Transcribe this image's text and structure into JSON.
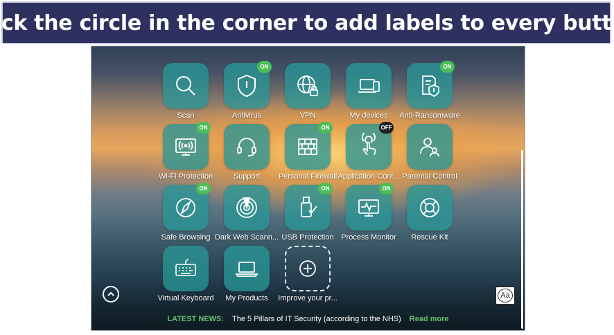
{
  "banner": {
    "text": "Click the circle in the corner to add labels to every button"
  },
  "colors": {
    "banner_bg": "#2e3160",
    "tile_bg": "#2a9696",
    "status_on": "#4dbd5a",
    "status_off": "#1e2226",
    "news_accent": "#66c36e"
  },
  "tiles": [
    {
      "label": "Scan",
      "icon": "search-icon",
      "status": ""
    },
    {
      "label": "Antivirus",
      "icon": "shield-icon",
      "status": "ON"
    },
    {
      "label": "VPN",
      "icon": "globe-lock-icon",
      "status": ""
    },
    {
      "label": "My devices",
      "icon": "devices-icon",
      "status": ""
    },
    {
      "label": "Anti-Ransomware",
      "icon": "document-shield-icon",
      "status": "ON"
    },
    {
      "label": "Wi-Fi Protection",
      "icon": "wifi-monitor-icon",
      "status": "ON"
    },
    {
      "label": "Support",
      "icon": "headset-icon",
      "status": ""
    },
    {
      "label": "Personal Firewall",
      "icon": "firewall-icon",
      "status": "ON"
    },
    {
      "label": "Application Cont...",
      "icon": "hand-touch-icon",
      "status": "OFF"
    },
    {
      "label": "Parental Control",
      "icon": "parent-child-icon",
      "status": ""
    },
    {
      "label": "Safe Browsing",
      "icon": "compass-icon",
      "status": "ON"
    },
    {
      "label": "Dark Web Scann...",
      "icon": "radar-icon",
      "status": ""
    },
    {
      "label": "USB Protection",
      "icon": "usb-check-icon",
      "status": "ON"
    },
    {
      "label": "Process Monitor",
      "icon": "monitor-pulse-icon",
      "status": "ON"
    },
    {
      "label": "Rescue Kit",
      "icon": "lifebuoy-icon",
      "status": ""
    },
    {
      "label": "Virtual Keyboard",
      "icon": "keyboard-icon",
      "status": ""
    },
    {
      "label": "My Products",
      "icon": "laptop-icon",
      "status": ""
    },
    {
      "label": "Improve your pr...",
      "icon": "plus-circle-icon",
      "status": ""
    }
  ],
  "controls": {
    "scroll_up_icon": "chevron-up-icon",
    "text_size_label": "Aa"
  },
  "news": {
    "heading": "LATEST NEWS:",
    "headline": "The 5 Pillars of IT Security (according to the NHS)",
    "read_more": "Read more"
  }
}
